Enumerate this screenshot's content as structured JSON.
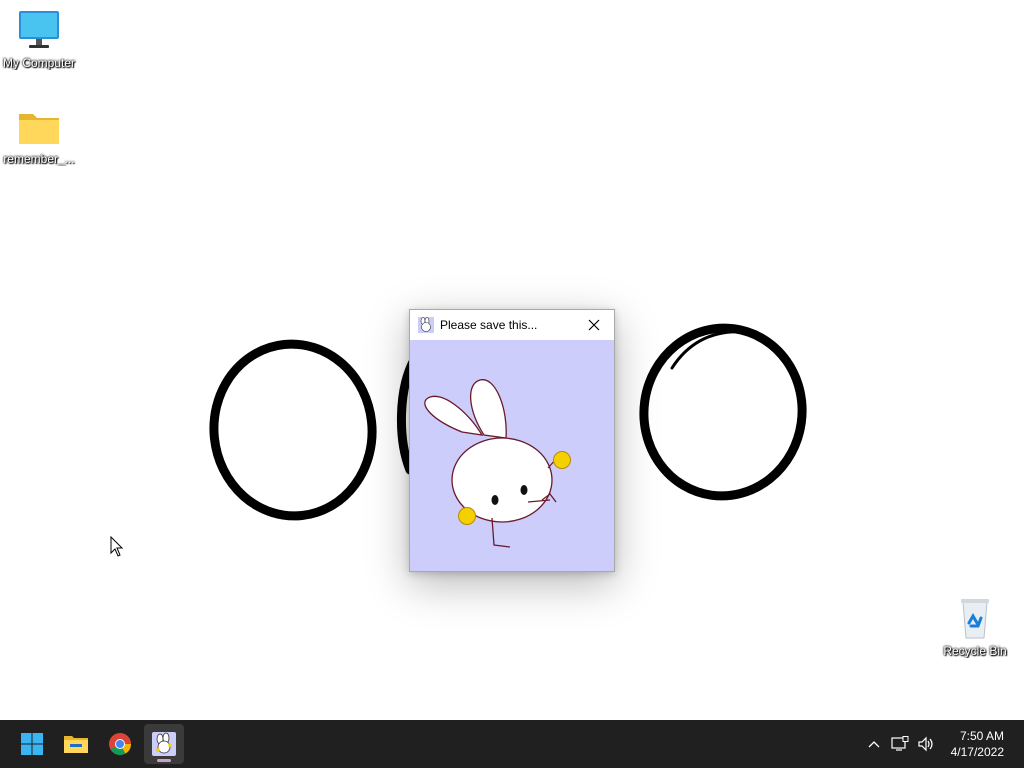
{
  "desktop": {
    "icons": [
      {
        "label": "My Computer",
        "icon": "monitor-icon"
      },
      {
        "label": "remember_...",
        "icon": "folder-icon"
      },
      {
        "label": "Recycle Bin",
        "icon": "recycle-bin-icon"
      }
    ]
  },
  "popup": {
    "title": "Please save this...",
    "app_icon": "bunny-icon",
    "close_icon": "close-icon",
    "background_color": "#cccdfb"
  },
  "taskbar": {
    "apps": [
      {
        "name": "Start",
        "icon": "windows-start-icon"
      },
      {
        "name": "File Explorer",
        "icon": "folder-icon"
      },
      {
        "name": "Google Chrome",
        "icon": "chrome-icon"
      },
      {
        "name": "Bunny app",
        "icon": "bunny-icon",
        "active": true
      }
    ],
    "tray": {
      "icons": [
        "chevron-up-icon",
        "network-icon",
        "volume-icon"
      ],
      "time": "7:50 AM",
      "date": "4/17/2022"
    }
  },
  "colors": {
    "taskbar_bg": "#202020",
    "desktop_bg": "#ffffff",
    "accent_yellow": "#f5d000"
  }
}
